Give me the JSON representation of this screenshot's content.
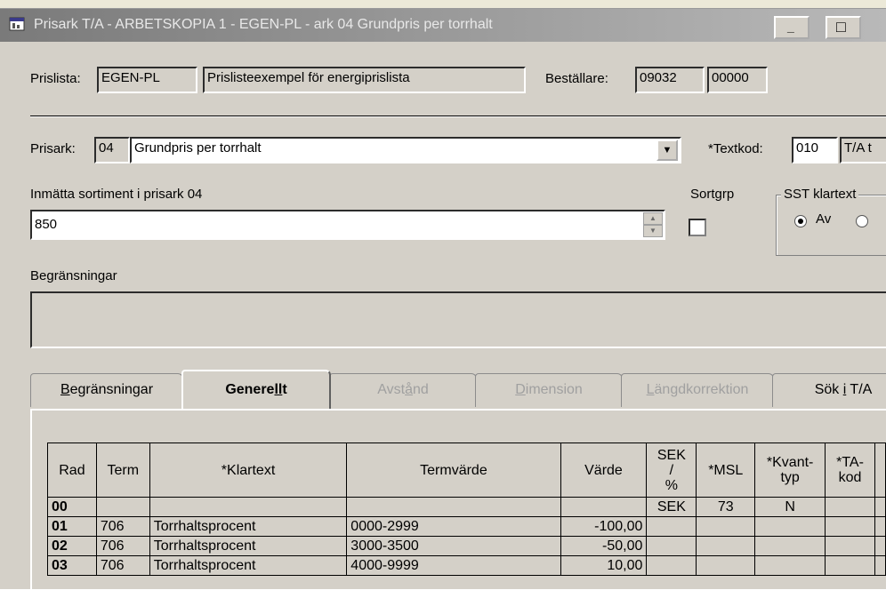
{
  "window": {
    "title": "Prisark T/A - ARBETSKOPIA 1 - EGEN-PL - ark 04 Grundpris per torrhalt",
    "minimize": "_",
    "maximize": "□"
  },
  "header": {
    "prislista_label": "Prislista:",
    "prislista_code": "EGEN-PL",
    "prislista_name": "Prislisteexempel för energiprislista",
    "bestallare_label": "Beställare:",
    "bestallare_code1": "09032",
    "bestallare_code2": "00000"
  },
  "prisark": {
    "label": "Prisark:",
    "number": "04",
    "name": "Grundpris per torrhalt",
    "textkod_label": "*Textkod:",
    "textkod_value": "010",
    "textkod_text": "T/A t"
  },
  "sortiment": {
    "label": "Inmätta sortiment i prisark 04",
    "value": "850",
    "sortgrp_label": "Sortgrp",
    "sst_label": "SST klartext",
    "radio_av": "Av"
  },
  "begransningar": {
    "label": "Begränsningar",
    "value": ""
  },
  "tabs": [
    {
      "pre": "",
      "u": "B",
      "post": "egränsningar",
      "state": "normal"
    },
    {
      "pre": "Genere",
      "u": "ll",
      "post": "t",
      "state": "active"
    },
    {
      "pre": "Avst",
      "u": "å",
      "post": "nd",
      "state": "disabled"
    },
    {
      "pre": "",
      "u": "D",
      "post": "imension",
      "state": "disabled"
    },
    {
      "pre": "",
      "u": "L",
      "post": "ängdkorrektion",
      "state": "disabled"
    },
    {
      "pre": "Sök ",
      "u": "i",
      "post": " T/A",
      "state": "normal"
    }
  ],
  "table": {
    "headers": [
      "Rad",
      "Term",
      "*Klartext",
      "Termvärde",
      "Värde",
      "SEK / %",
      "*MSL",
      "*Kvant- typ",
      "*TA- kod",
      ""
    ],
    "rows": [
      {
        "rad": "00",
        "term": "",
        "klartext": "",
        "termvarde": "",
        "varde": "",
        "sek": "SEK",
        "msl": "73",
        "kvant": "N",
        "ta": ""
      },
      {
        "rad": "01",
        "term": "706",
        "klartext": "Torrhaltsprocent",
        "termvarde": "0000-2999",
        "varde": "-100,00",
        "sek": "",
        "msl": "",
        "kvant": "",
        "ta": ""
      },
      {
        "rad": "02",
        "term": "706",
        "klartext": "Torrhaltsprocent",
        "termvarde": "3000-3500",
        "varde": "-50,00",
        "sek": "",
        "msl": "",
        "kvant": "",
        "ta": ""
      },
      {
        "rad": "03",
        "term": "706",
        "klartext": "Torrhaltsprocent",
        "termvarde": "4000-9999",
        "varde": "10,00",
        "sek": "",
        "msl": "",
        "kvant": "",
        "ta": ""
      }
    ]
  }
}
